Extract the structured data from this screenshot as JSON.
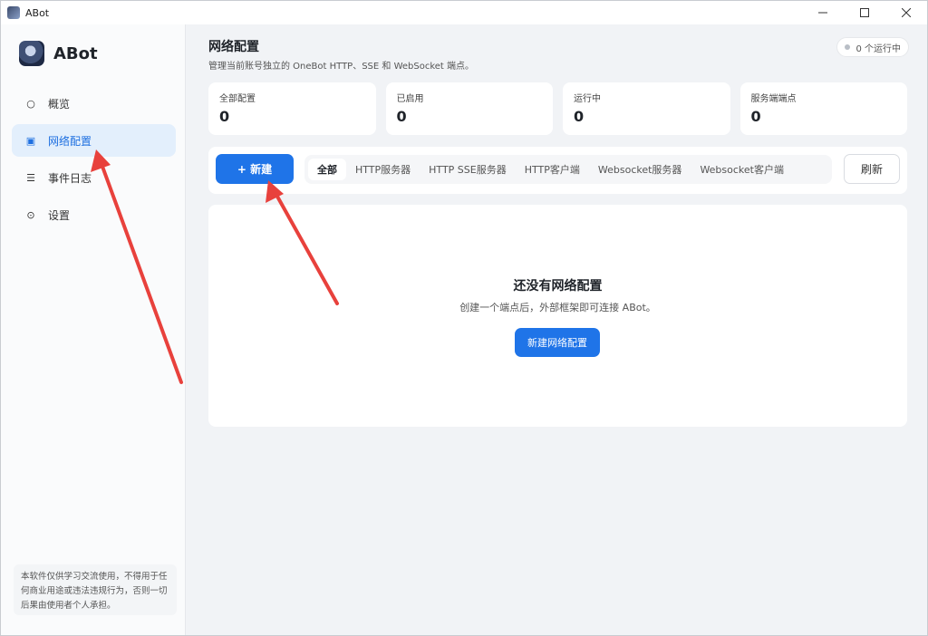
{
  "window": {
    "title": "ABot",
    "controls": [
      "minimize-icon",
      "maximize-icon",
      "close-icon"
    ]
  },
  "sidebar": {
    "brand": "ABot",
    "items": [
      {
        "label": "概览",
        "icon": "circle-icon"
      },
      {
        "label": "网络配置",
        "icon": "square-icon",
        "active": true
      },
      {
        "label": "事件日志",
        "icon": "menu-icon"
      },
      {
        "label": "设置",
        "icon": "settings-icon"
      }
    ],
    "disclaimer": "本软件仅供学习交流使用，不得用于任何商业用途或违法违规行为，否则一切后果由使用者个人承担。"
  },
  "header": {
    "title": "网络配置",
    "subtitle": "管理当前账号独立的 OneBot HTTP、SSE 和 WebSocket 端点。",
    "status": "0 个运行中"
  },
  "stats": [
    {
      "label": "全部配置",
      "value": "0"
    },
    {
      "label": "已启用",
      "value": "0"
    },
    {
      "label": "运行中",
      "value": "0"
    },
    {
      "label": "服务端端点",
      "value": "0"
    }
  ],
  "toolbar": {
    "new_label": "+ 新建",
    "tabs": [
      "全部",
      "HTTP服务器",
      "HTTP SSE服务器",
      "HTTP客户端",
      "Websocket服务器",
      "Websocket客户端"
    ],
    "refresh_label": "刷新"
  },
  "empty": {
    "title": "还没有网络配置",
    "description": "创建一个端点后，外部框架即可连接 ABot。",
    "button": "新建网络配置"
  },
  "colors": {
    "accent": "#1f74e8",
    "annotation_arrow": "#e8413c"
  }
}
